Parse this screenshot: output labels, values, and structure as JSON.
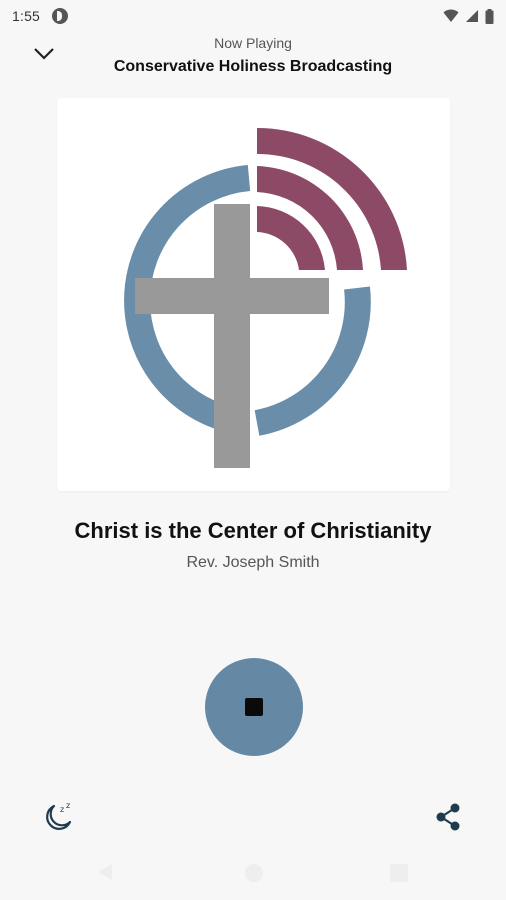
{
  "status_bar": {
    "time": "1:55",
    "icons": [
      "app-notification-icon",
      "wifi-icon",
      "cell-signal-icon",
      "battery-icon"
    ]
  },
  "header": {
    "collapse_icon": "chevron-down-icon",
    "label": "Now Playing",
    "station": "Conservative Holiness Broadcasting"
  },
  "artwork": {
    "logo": "cross-with-broadcast-waves-logo",
    "colors": {
      "ring": "#6a8ea9",
      "cross": "#999999",
      "waves": "#8d4a66"
    }
  },
  "track": {
    "title": "Christ is the Center of Christianity",
    "artist": "Rev. Joseph Smith"
  },
  "controls": {
    "stop_icon": "stop-icon",
    "sleep_timer_icon": "sleep-timer-moon-icon",
    "share_icon": "share-icon",
    "accent": "#6589a4"
  },
  "nav_bar": {
    "icons": [
      "back-triangle-icon",
      "home-circle-icon",
      "recents-square-icon"
    ]
  }
}
